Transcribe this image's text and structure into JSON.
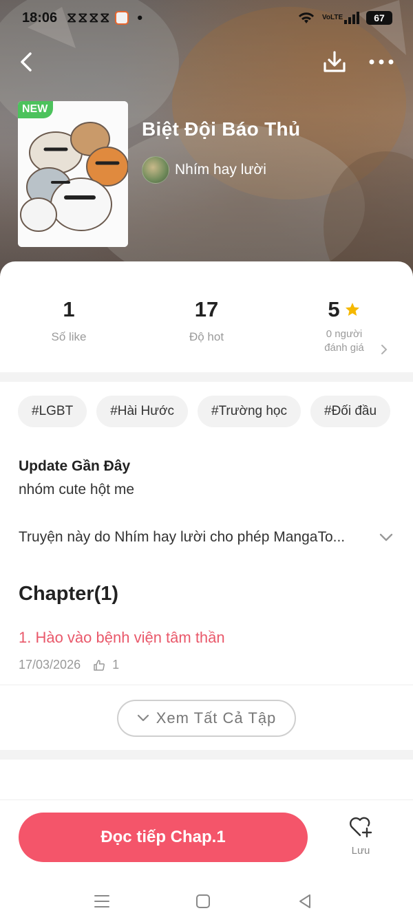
{
  "status_bar": {
    "time": "18:06",
    "notification_glyphs": [
      "ᛟ",
      "ᛟ",
      "ᛟ",
      "ᛟ"
    ],
    "battery": "67",
    "network": "VoLTE"
  },
  "comic": {
    "badge": "NEW",
    "title": "Biệt Đội Báo Thủ",
    "author": "Nhím hay lười"
  },
  "stats": [
    {
      "value": "1",
      "label": "Số like"
    },
    {
      "value": "17",
      "label": "Độ hot"
    },
    {
      "value": "5",
      "label_line1": "0 người",
      "label_line2": "đánh giá"
    }
  ],
  "tags": [
    "#LGBT",
    "#Hài Hước",
    "#Trường học",
    "#Đối đầu"
  ],
  "update": {
    "heading": "Update Gần Đây",
    "text": "nhóm cute hột me"
  },
  "description": "Truyện này do Nhím hay lười cho phép MangaTo...",
  "chapters": {
    "heading": "Chapter(1)",
    "items": [
      {
        "title": "1. Hào vào bệnh viện tâm thần",
        "date": "17/03/2026",
        "likes": "1"
      }
    ],
    "view_all": "Xem Tất Cả Tập"
  },
  "actions": {
    "read_label": "Đọc tiếp Chap.1",
    "save_label": "Lưu"
  },
  "colors": {
    "accent": "#f4556a",
    "chapter_link": "#e9586a",
    "badge_green": "#4cc25c",
    "star": "#f5b800"
  }
}
